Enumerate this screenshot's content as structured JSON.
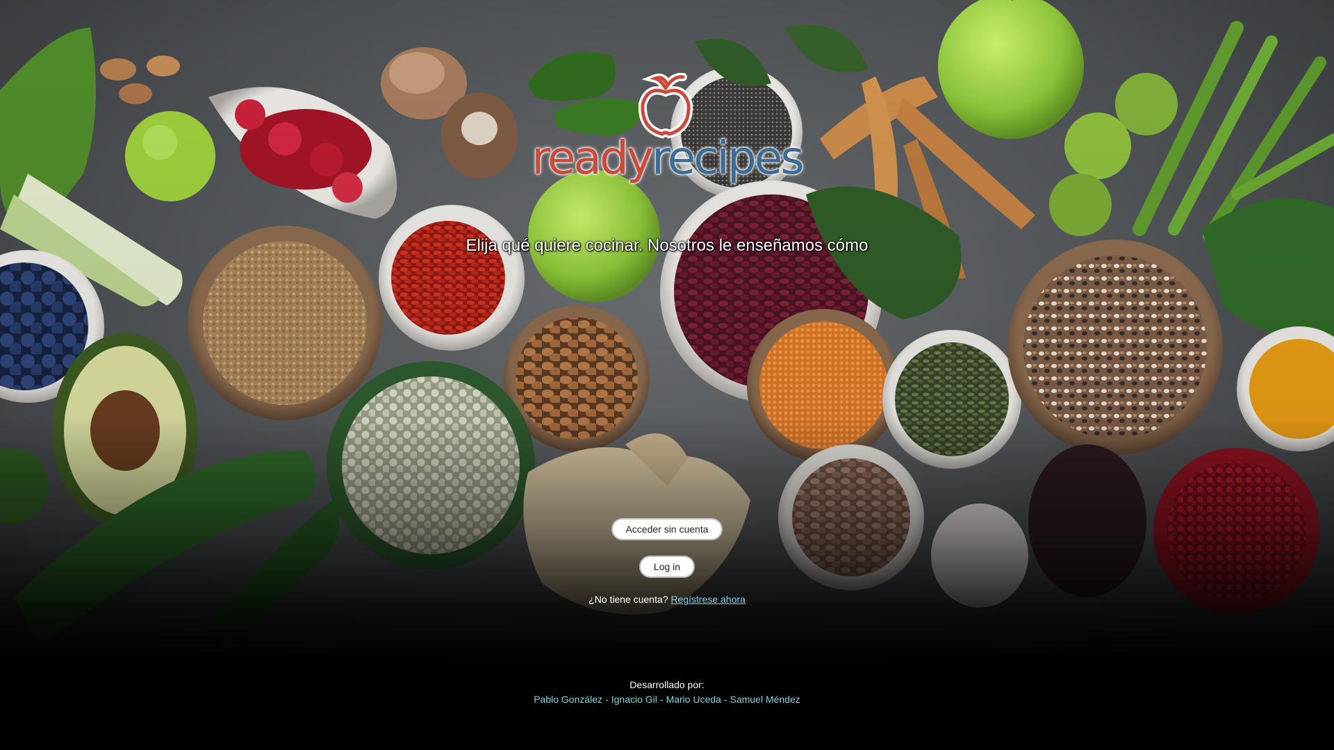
{
  "logo": {
    "part_ready": "ready",
    "part_recipes": "recipes",
    "icon": "apple-logo-icon"
  },
  "tagline": "Elija qué quiere cocinar. Nosotros le enseñamos cómo",
  "actions": {
    "guest_label": "Acceder sin cuenta",
    "login_label": "Log in",
    "no_account_text": "¿No tiene cuenta?",
    "signup_link": "Regístrese ahora"
  },
  "footer": {
    "title": "Desarrollado por:",
    "developers": [
      "Pablo González",
      "Ignacio Gil",
      "Mario Uceda",
      "Samuel Méndez"
    ],
    "separator": "-"
  },
  "colors": {
    "brand_red": "#c84b3e",
    "brand_blue": "#3e6b93",
    "link_cyan": "#7fd6e6",
    "background": "#000000"
  }
}
